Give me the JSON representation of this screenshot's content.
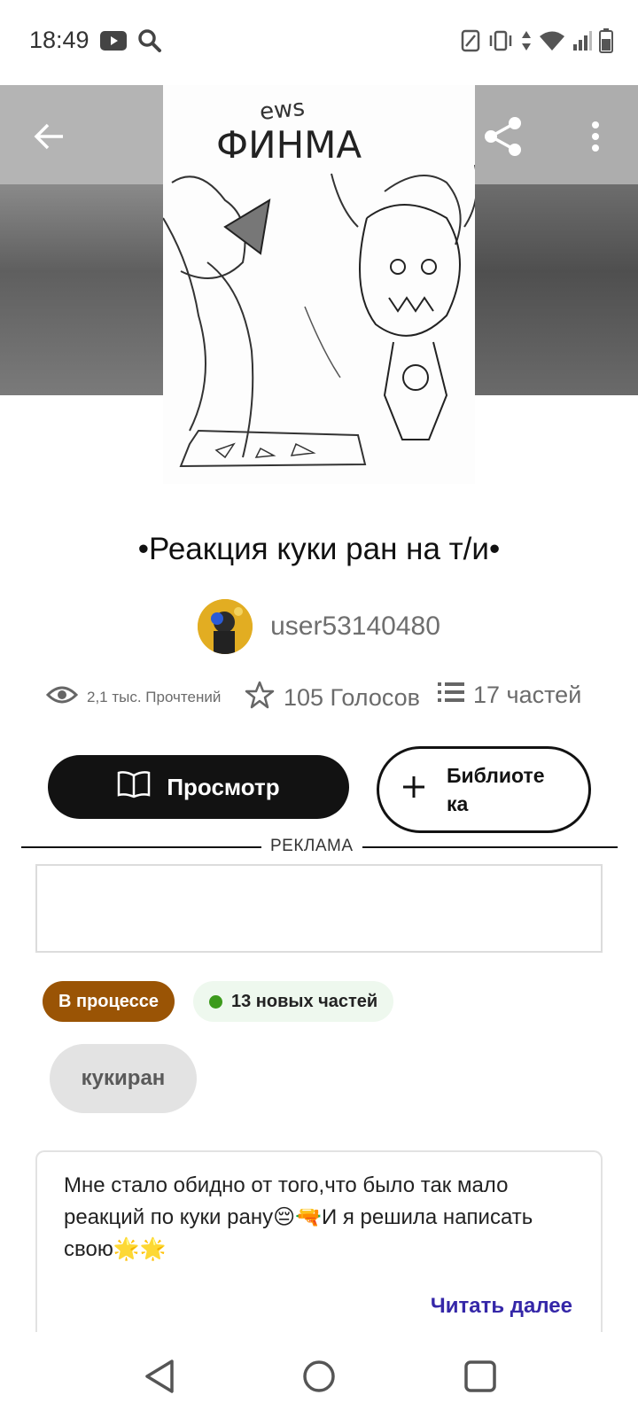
{
  "status_bar": {
    "time": "18:49",
    "left_icons": [
      "youtube-icon",
      "search-icon"
    ],
    "right_icons": [
      "nfc-icon",
      "vibrate-icon",
      "data-arrows-icon",
      "wifi-icon",
      "signal-icon",
      "battery-icon"
    ]
  },
  "header": {
    "back_icon": "arrow-left-icon",
    "share_icon": "share-icon",
    "more_icon": "more-vertical-icon",
    "cover_text": "ФИНМА"
  },
  "story": {
    "title": "•Реакция куки ран на т/и•",
    "author": "user53140480",
    "stats": {
      "reads": "2,1 тыс. Прочтений",
      "votes": "105 Голосов",
      "parts": "17 частей"
    }
  },
  "actions": {
    "read_label": "Просмотр",
    "library_label": "Библиоте ка"
  },
  "ad": {
    "label": "РЕКЛАМА"
  },
  "badges": {
    "status": "В процессе",
    "new_parts": "13 новых частей"
  },
  "tags": [
    "кукиран"
  ],
  "description": {
    "text": "Мне стало обидно от того,что было так мало реакций по куки рану😔🔫И я решила написать свою🌟🌟",
    "read_more": "Читать далее"
  },
  "colors": {
    "status_badge": "#9a5405",
    "new_dot": "#3c9a1c",
    "read_more": "#3527a8",
    "primary_button": "#121212"
  },
  "system_nav": [
    "back-icon",
    "home-icon",
    "recents-icon"
  ]
}
